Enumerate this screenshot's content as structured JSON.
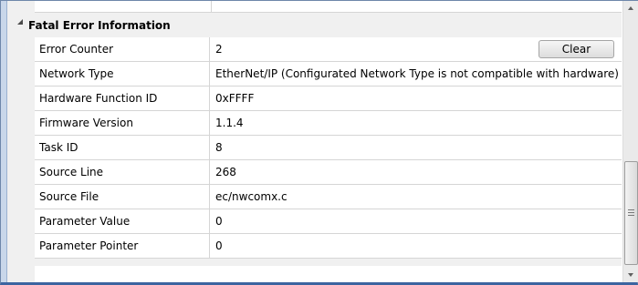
{
  "section": {
    "title": "Fatal Error Information",
    "expand_icon": "triangle-expanded-icon"
  },
  "rows": [
    {
      "name": "Error Counter",
      "value": "2",
      "button": "Clear"
    },
    {
      "name": "Network Type",
      "value": "EtherNet/IP (Configurated Network Type is not compatible with hardware)"
    },
    {
      "name": "Hardware Function ID",
      "value": "0xFFFF"
    },
    {
      "name": "Firmware Version",
      "value": "1.1.4"
    },
    {
      "name": "Task ID",
      "value": "8"
    },
    {
      "name": "Source Line",
      "value": "268"
    },
    {
      "name": "Source File",
      "value": "ec/nwcomx.c"
    },
    {
      "name": "Parameter Value",
      "value": "0"
    },
    {
      "name": "Parameter Pointer",
      "value": "0"
    }
  ],
  "colors": {
    "frame_border": "#3c64a0",
    "grid_line": "#d5d5d5",
    "category_bg": "#f0f0f0"
  }
}
